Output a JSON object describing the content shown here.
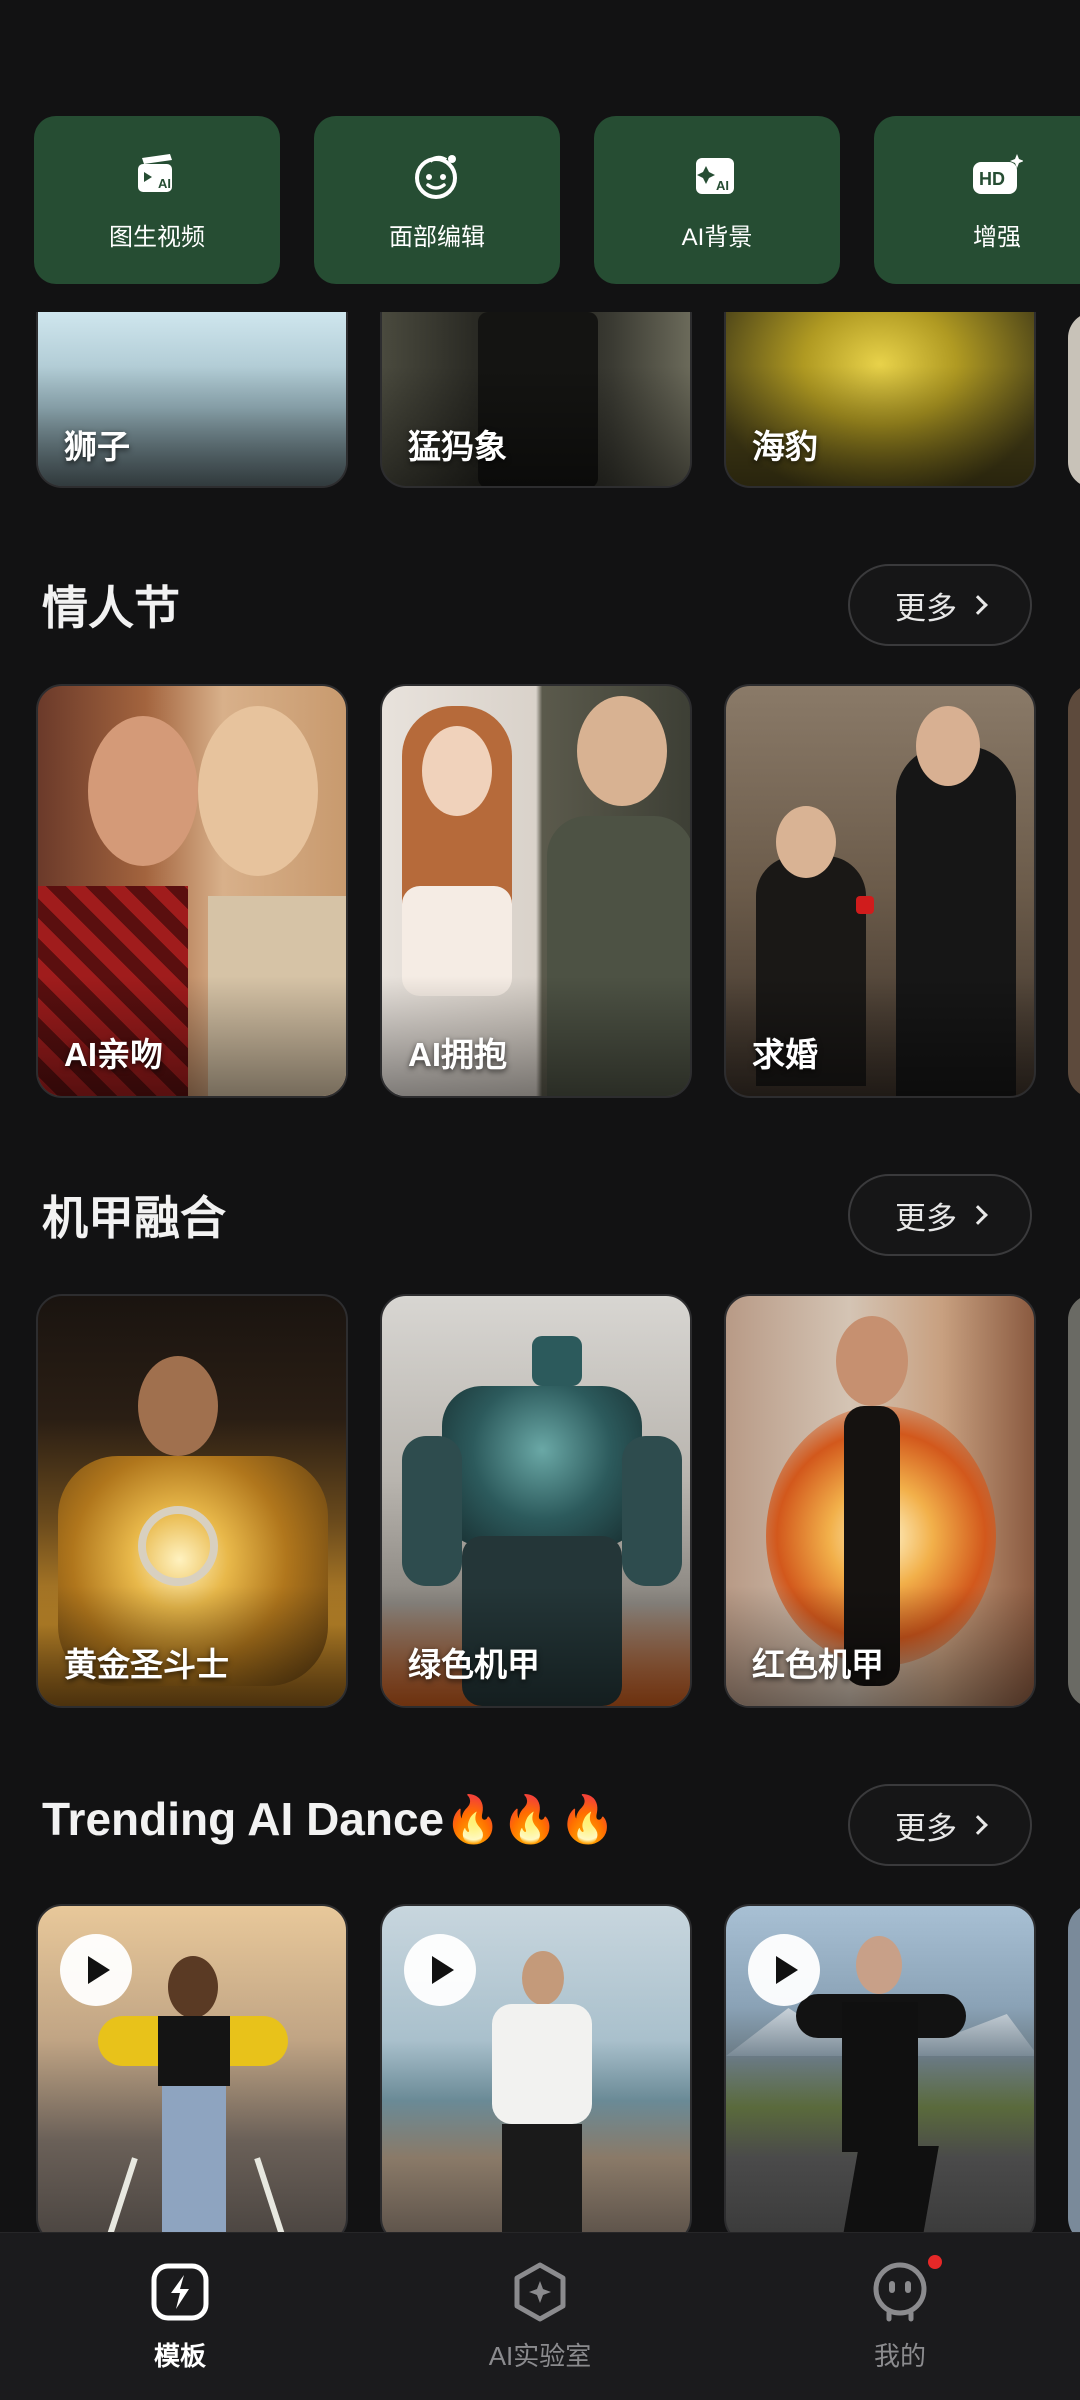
{
  "tools": [
    {
      "label": "图生视频",
      "icon": "image-to-video-icon"
    },
    {
      "label": "面部编辑",
      "icon": "face-edit-icon"
    },
    {
      "label": "AI背景",
      "icon": "ai-background-icon"
    },
    {
      "label": "增强",
      "icon": "hd-enhance-icon"
    }
  ],
  "top_row": [
    {
      "caption": "狮子"
    },
    {
      "caption": "猛犸象"
    },
    {
      "caption": "海豹"
    }
  ],
  "sections": [
    {
      "title": "情人节",
      "more": "更多",
      "cards": [
        {
          "caption": "AI亲吻"
        },
        {
          "caption": "AI拥抱"
        },
        {
          "caption": "求婚"
        }
      ]
    },
    {
      "title": "机甲融合",
      "more": "更多",
      "cards": [
        {
          "caption": "黄金圣斗士"
        },
        {
          "caption": "绿色机甲"
        },
        {
          "caption": "红色机甲"
        }
      ]
    },
    {
      "title": "Trending AI Dance🔥🔥🔥",
      "more": "更多",
      "cards": [
        {
          "caption": ""
        },
        {
          "caption": ""
        },
        {
          "caption": ""
        }
      ]
    }
  ],
  "nav": [
    {
      "label": "模板",
      "icon": "template-icon",
      "active": true
    },
    {
      "label": "AI实验室",
      "icon": "ai-lab-icon",
      "active": false
    },
    {
      "label": "我的",
      "icon": "profile-icon",
      "active": false,
      "badge": true
    }
  ],
  "colors": {
    "background": "#121213",
    "tool_tile": "#264d33",
    "badge": "#e62828"
  }
}
